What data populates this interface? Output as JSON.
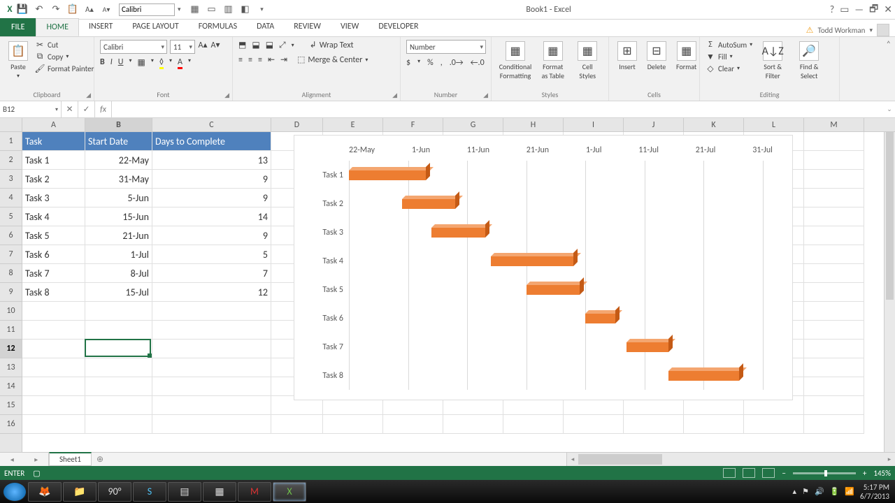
{
  "app": {
    "title": "Book1 - Excel"
  },
  "qat_font": "Calibri",
  "user": {
    "name": "Todd Workman"
  },
  "tabs": [
    "FILE",
    "HOME",
    "INSERT",
    "PAGE LAYOUT",
    "FORMULAS",
    "DATA",
    "REVIEW",
    "VIEW",
    "DEVELOPER"
  ],
  "active_tab": "HOME",
  "ribbon": {
    "clipboard": {
      "label": "Clipboard",
      "paste": "Paste",
      "cut": "Cut",
      "copy": "Copy",
      "fmtpaint": "Format Painter"
    },
    "font": {
      "label": "Font",
      "name": "Calibri",
      "size": "11"
    },
    "alignment": {
      "label": "Alignment",
      "wrap": "Wrap Text",
      "merge": "Merge & Center"
    },
    "number": {
      "label": "Number",
      "format": "Number"
    },
    "styles": {
      "label": "Styles",
      "cond": "Conditional Formatting",
      "table": "Format as Table",
      "cell": "Cell Styles"
    },
    "cells": {
      "label": "Cells",
      "insert": "Insert",
      "delete": "Delete",
      "format": "Format"
    },
    "editing": {
      "label": "Editing",
      "autosum": "AutoSum",
      "fill": "Fill",
      "clear": "Clear",
      "sort": "Sort & Filter",
      "find": "Find & Select"
    }
  },
  "namebox": "B12",
  "formula": "",
  "columns": [
    {
      "l": "A",
      "w": 90
    },
    {
      "l": "B",
      "w": 96
    },
    {
      "l": "C",
      "w": 170
    },
    {
      "l": "D",
      "w": 74
    },
    {
      "l": "E",
      "w": 86
    },
    {
      "l": "F",
      "w": 86
    },
    {
      "l": "G",
      "w": 86
    },
    {
      "l": "H",
      "w": 86
    },
    {
      "l": "I",
      "w": 86
    },
    {
      "l": "J",
      "w": 86
    },
    {
      "l": "K",
      "w": 86
    },
    {
      "l": "L",
      "w": 86
    },
    {
      "l": "M",
      "w": 86
    }
  ],
  "row_count": 16,
  "selected_col": "B",
  "selected_row": 12,
  "table": {
    "headers": [
      "Task",
      "Start Date",
      "Days to Complete"
    ],
    "rows": [
      {
        "task": "Task 1",
        "start": "22-May",
        "days": 13
      },
      {
        "task": "Task 2",
        "start": "31-May",
        "days": 9
      },
      {
        "task": "Task 3",
        "start": "5-Jun",
        "days": 9
      },
      {
        "task": "Task 4",
        "start": "15-Jun",
        "days": 14
      },
      {
        "task": "Task 5",
        "start": "21-Jun",
        "days": 9
      },
      {
        "task": "Task 6",
        "start": "1-Jul",
        "days": 5
      },
      {
        "task": "Task 7",
        "start": "8-Jul",
        "days": 7
      },
      {
        "task": "Task 8",
        "start": "15-Jul",
        "days": 12
      }
    ]
  },
  "chart_data": {
    "type": "gantt",
    "x_ticks": [
      "22-May",
      "1-Jun",
      "11-Jun",
      "21-Jun",
      "1-Jul",
      "11-Jul",
      "21-Jul",
      "31-Jul"
    ],
    "x_range_days": 70,
    "series": [
      {
        "name": "Task 1",
        "start_offset": 0,
        "duration": 13
      },
      {
        "name": "Task 2",
        "start_offset": 9,
        "duration": 9
      },
      {
        "name": "Task 3",
        "start_offset": 14,
        "duration": 9
      },
      {
        "name": "Task 4",
        "start_offset": 24,
        "duration": 14
      },
      {
        "name": "Task 5",
        "start_offset": 30,
        "duration": 9
      },
      {
        "name": "Task 6",
        "start_offset": 40,
        "duration": 5
      },
      {
        "name": "Task 7",
        "start_offset": 47,
        "duration": 7
      },
      {
        "name": "Task 8",
        "start_offset": 54,
        "duration": 12
      }
    ]
  },
  "sheet_tab": "Sheet1",
  "status": {
    "mode": "ENTER",
    "zoom": "145%"
  },
  "taskbar": {
    "weather": "90°",
    "time": "5:17 PM",
    "date": "6/7/2013"
  }
}
